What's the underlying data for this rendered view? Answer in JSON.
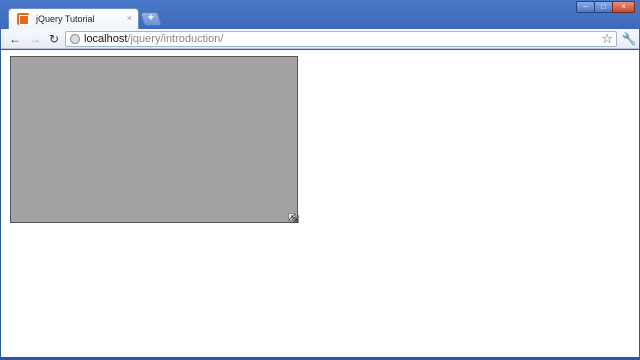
{
  "window": {
    "controls": {
      "minimize": "–",
      "maximize": "□",
      "close": "×"
    }
  },
  "tabs": [
    {
      "title": "jQuery Tutorial",
      "close": "×",
      "active": true
    }
  ],
  "new_tab": "+",
  "toolbar": {
    "back": "←",
    "forward": "→",
    "reload": "↻",
    "address": {
      "host": "localhost",
      "path": "/jquery/introduction/"
    },
    "star": "☆",
    "wrench": "🔧"
  },
  "colors": {
    "box_fill": "#a3a3a5",
    "frame": "#2c56a8"
  }
}
